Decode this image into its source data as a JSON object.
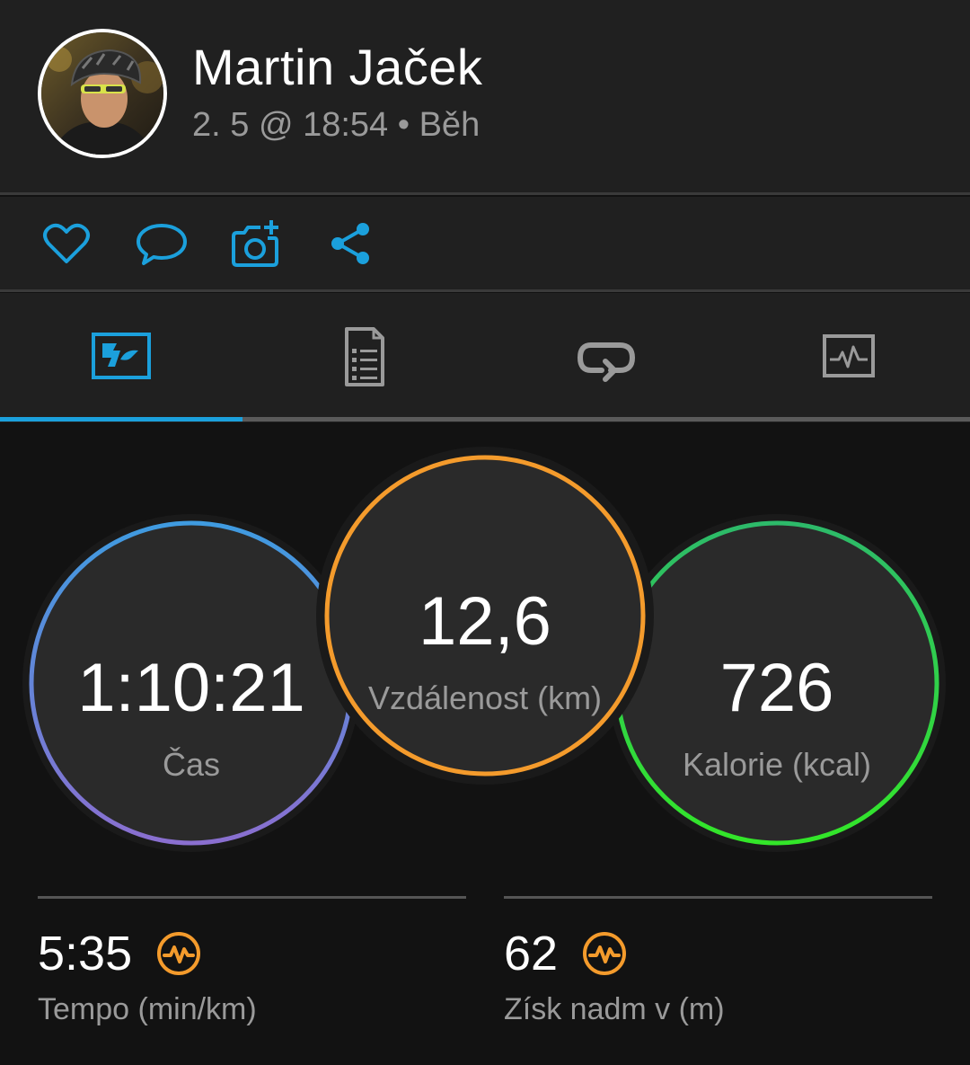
{
  "header": {
    "user_name": "Martin Jaček",
    "subline": "2. 5 @ 18:54 • Běh"
  },
  "actions": [
    {
      "icon": "heart-icon"
    },
    {
      "icon": "comment-icon"
    },
    {
      "icon": "add-photo-icon"
    },
    {
      "icon": "share-icon"
    }
  ],
  "tabs": [
    {
      "icon": "map-overview-icon",
      "active": true
    },
    {
      "icon": "details-document-icon",
      "active": false
    },
    {
      "icon": "laps-icon",
      "active": false
    },
    {
      "icon": "charts-icon",
      "active": false
    }
  ],
  "stats": {
    "time": {
      "value": "1:10:21",
      "label": "Čas"
    },
    "distance": {
      "value": "12,6",
      "label": "Vzdálenost (km)"
    },
    "calories": {
      "value": "726",
      "label": "Kalorie (kcal)"
    }
  },
  "metrics": {
    "pace": {
      "value": "5:35",
      "label": "Tempo (min/km)",
      "icon": "activity-pulse-icon"
    },
    "elevation": {
      "value": "62",
      "label": "Získ nadm v (m)",
      "icon": "activity-pulse-icon"
    }
  },
  "colors": {
    "accent": "#1ba0dc",
    "time_ring_top": "#3f9be0",
    "time_ring_bottom": "#8a6fd0",
    "distance_ring": "#f49b2c",
    "calories_ring_top": "#2dba6a",
    "calories_ring_bottom": "#33e629",
    "metric_icon": "#f49b2c"
  }
}
